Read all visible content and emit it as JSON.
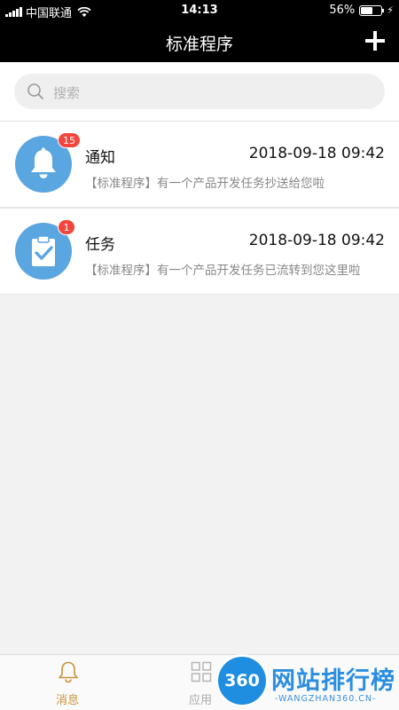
{
  "status_bar": {
    "carrier": "中国联通",
    "time": "14:13",
    "battery_percent": "56%",
    "battery_level": 0.56
  },
  "nav": {
    "title": "标准程序",
    "add_icon": "plus-icon"
  },
  "search": {
    "placeholder": "搜索"
  },
  "messages": [
    {
      "title": "通知",
      "time": "2018-09-18 09:42",
      "subtitle": "【标准程序】有一个产品开发任务抄送给您啦",
      "badge": "15",
      "icon": "bell-icon",
      "color": "#5aa6e0"
    },
    {
      "title": "任务",
      "time": "2018-09-18 09:42",
      "subtitle": "【标准程序】有一个产品开发任务已流转到您这里啦",
      "badge": "1",
      "icon": "clipboard-check-icon",
      "color": "#5aa6e0"
    }
  ],
  "tabs": [
    {
      "label": "消息",
      "icon": "bell-outline-icon",
      "active": true
    },
    {
      "label": "应用",
      "icon": "apps-grid-icon",
      "active": false
    }
  ],
  "colors": {
    "accent": "#c9923a",
    "badge": "#f2453d",
    "avatar": "#5aa6e0"
  },
  "watermark": {
    "logo_text": "360",
    "text": "网站排行榜",
    "url": "-WANGZHAN360.CN-"
  }
}
